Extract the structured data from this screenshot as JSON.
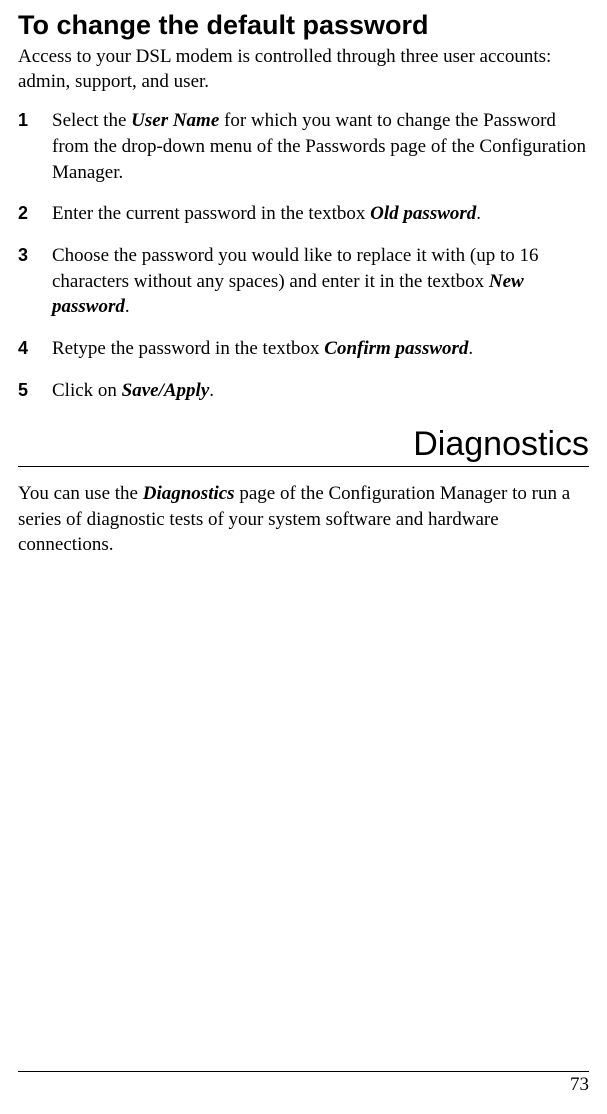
{
  "heading_main": "To change the default password",
  "intro": "Access to your DSL modem is controlled through three user accounts: admin, support, and user.",
  "steps": [
    {
      "num": "1",
      "pre": "Select the ",
      "bi": "User Name",
      "post": " for which you want to change the Password from the drop-down menu of the Passwords page of the Configuration Manager."
    },
    {
      "num": "2",
      "pre": "Enter the current password in the textbox ",
      "bi": "Old password",
      "post": "."
    },
    {
      "num": "3",
      "pre": "Choose the password you would like to replace it with (up to 16 characters without any spaces) and enter it in the textbox ",
      "bi": "New password",
      "post": "."
    },
    {
      "num": "4",
      "pre": "Retype the password in the textbox ",
      "bi": "Confirm password",
      "post": "."
    },
    {
      "num": "5",
      "pre": "Click on ",
      "bi": "Save/Apply",
      "post": "."
    }
  ],
  "heading_section": "Diagnostics",
  "section_text_pre": "You can use the ",
  "section_text_bi": "Diagnostics",
  "section_text_post": " page of the Configuration Manager to run a series of diagnostic tests of your system software and hardware connections.",
  "page_number": "73"
}
